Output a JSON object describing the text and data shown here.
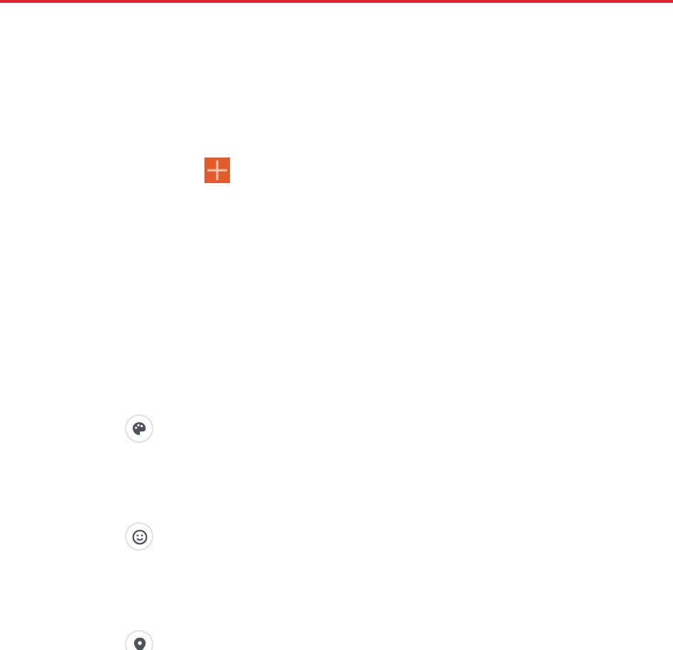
{
  "add_button": {
    "kind": "plus"
  },
  "tools": [
    {
      "kind": "palette"
    },
    {
      "kind": "emoji"
    },
    {
      "kind": "location"
    }
  ]
}
